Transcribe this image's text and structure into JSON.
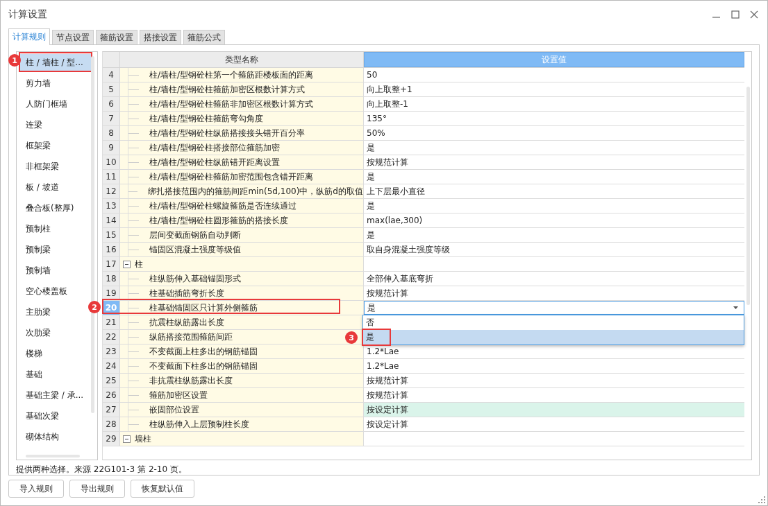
{
  "window": {
    "title": "计算设置"
  },
  "tabs": [
    {
      "label": "计算规则",
      "selected": true
    },
    {
      "label": "节点设置",
      "selected": false
    },
    {
      "label": "箍筋设置",
      "selected": false
    },
    {
      "label": "搭接设置",
      "selected": false
    },
    {
      "label": "箍筋公式",
      "selected": false
    }
  ],
  "sidebar": {
    "items": [
      {
        "label": "柱 / 墙柱 / 型...",
        "selected": true,
        "badge": "1"
      },
      {
        "label": "剪力墙",
        "selected": false
      },
      {
        "label": "人防门框墙",
        "selected": false
      },
      {
        "label": "连梁",
        "selected": false
      },
      {
        "label": "框架梁",
        "selected": false
      },
      {
        "label": "非框架梁",
        "selected": false
      },
      {
        "label": "板 / 坡道",
        "selected": false
      },
      {
        "label": "叠合板(整厚)",
        "selected": false
      },
      {
        "label": "预制柱",
        "selected": false
      },
      {
        "label": "预制梁",
        "selected": false
      },
      {
        "label": "预制墙",
        "selected": false
      },
      {
        "label": "空心楼盖板",
        "selected": false
      },
      {
        "label": "主肋梁",
        "selected": false
      },
      {
        "label": "次肋梁",
        "selected": false
      },
      {
        "label": "楼梯",
        "selected": false
      },
      {
        "label": "基础",
        "selected": false
      },
      {
        "label": "基础主梁 / 承...",
        "selected": false
      },
      {
        "label": "基础次梁",
        "selected": false
      },
      {
        "label": "砌体结构",
        "selected": false
      }
    ]
  },
  "table": {
    "columns": [
      "类型名称",
      "设置值"
    ],
    "rows": [
      {
        "num": "4",
        "kind": "item",
        "name": "柱/墙柱/型钢砼柱第一个箍筋距楼板面的距离",
        "value": "50",
        "selected": false
      },
      {
        "num": "5",
        "kind": "item",
        "name": "柱/墙柱/型钢砼柱箍筋加密区根数计算方式",
        "value": "向上取整+1",
        "selected": false
      },
      {
        "num": "6",
        "kind": "item",
        "name": "柱/墙柱/型钢砼柱箍筋非加密区根数计算方式",
        "value": "向上取整-1",
        "selected": false
      },
      {
        "num": "7",
        "kind": "item",
        "name": "柱/墙柱/型钢砼柱箍筋弯勾角度",
        "value": "135°",
        "selected": false
      },
      {
        "num": "8",
        "kind": "item",
        "name": "柱/墙柱/型钢砼柱纵筋搭接接头错开百分率",
        "value": "50%",
        "selected": false
      },
      {
        "num": "9",
        "kind": "item",
        "name": "柱/墙柱/型钢砼柱搭接部位箍筋加密",
        "value": "是",
        "selected": false
      },
      {
        "num": "10",
        "kind": "item",
        "name": "柱/墙柱/型钢砼柱纵筋错开距离设置",
        "value": "按规范计算",
        "selected": false
      },
      {
        "num": "11",
        "kind": "item",
        "name": "柱/墙柱/型钢砼柱箍筋加密范围包含错开距离",
        "value": "是",
        "selected": false
      },
      {
        "num": "12",
        "kind": "item",
        "name": "绑扎搭接范围内的箍筋间距min(5d,100)中，纵筋d的取值",
        "value": "上下层最小直径",
        "selected": false
      },
      {
        "num": "13",
        "kind": "item",
        "name": "柱/墙柱/型钢砼柱螺旋箍筋是否连续通过",
        "value": "是",
        "selected": false
      },
      {
        "num": "14",
        "kind": "item",
        "name": "柱/墙柱/型钢砼柱圆形箍筋的搭接长度",
        "value": "max(lae,300)",
        "selected": false
      },
      {
        "num": "15",
        "kind": "item",
        "name": "层间变截面钢筋自动判断",
        "value": "是",
        "selected": false
      },
      {
        "num": "16",
        "kind": "item",
        "name": "锚固区混凝土强度等级值",
        "value": "取自身混凝土强度等级",
        "selected": false
      },
      {
        "num": "17",
        "kind": "group",
        "name": "柱",
        "expanded": true,
        "selected": false
      },
      {
        "num": "18",
        "kind": "item",
        "name": "柱纵筋伸入基础锚固形式",
        "value": "全部伸入基底弯折",
        "selected": false
      },
      {
        "num": "19",
        "kind": "item",
        "name": "柱基础插筋弯折长度",
        "value": "按规范计算",
        "selected": false
      },
      {
        "num": "20",
        "kind": "combo",
        "name": "柱基础锚固区只计算外侧箍筋",
        "value": "是",
        "selected": true,
        "badge": "2",
        "options": [
          {
            "label": "否",
            "selected": false
          },
          {
            "label": "是",
            "selected": true,
            "badge": "3"
          }
        ]
      },
      {
        "num": "21",
        "kind": "item",
        "name": "抗震柱纵筋露出长度",
        "selected": false
      },
      {
        "num": "22",
        "kind": "item",
        "name": "纵筋搭接范围箍筋间距",
        "selected": false
      },
      {
        "num": "23",
        "kind": "item",
        "name": "不变截面上柱多出的钢筋锚固",
        "value": "1.2*Lae",
        "selected": false
      },
      {
        "num": "24",
        "kind": "item",
        "name": "不变截面下柱多出的钢筋锚固",
        "value": "1.2*Lae",
        "selected": false
      },
      {
        "num": "25",
        "kind": "item",
        "name": "非抗震柱纵筋露出长度",
        "value": "按规范计算",
        "selected": false
      },
      {
        "num": "26",
        "kind": "item",
        "name": "箍筋加密区设置",
        "value": "按规范计算",
        "selected": false
      },
      {
        "num": "27",
        "kind": "item",
        "name": "嵌固部位设置",
        "value": "按设定计算",
        "selected": false,
        "highlighted": true
      },
      {
        "num": "28",
        "kind": "item",
        "name": "柱纵筋伸入上层预制柱长度",
        "value": "按设定计算",
        "selected": false
      },
      {
        "num": "29",
        "kind": "group",
        "name": "墙柱",
        "expanded": true,
        "selected": false
      }
    ]
  },
  "hint": "提供两种选择。来源 22G101-3 第 2-10 页。",
  "buttons": [
    "导入规则",
    "导出规则",
    "恢复默认值"
  ]
}
